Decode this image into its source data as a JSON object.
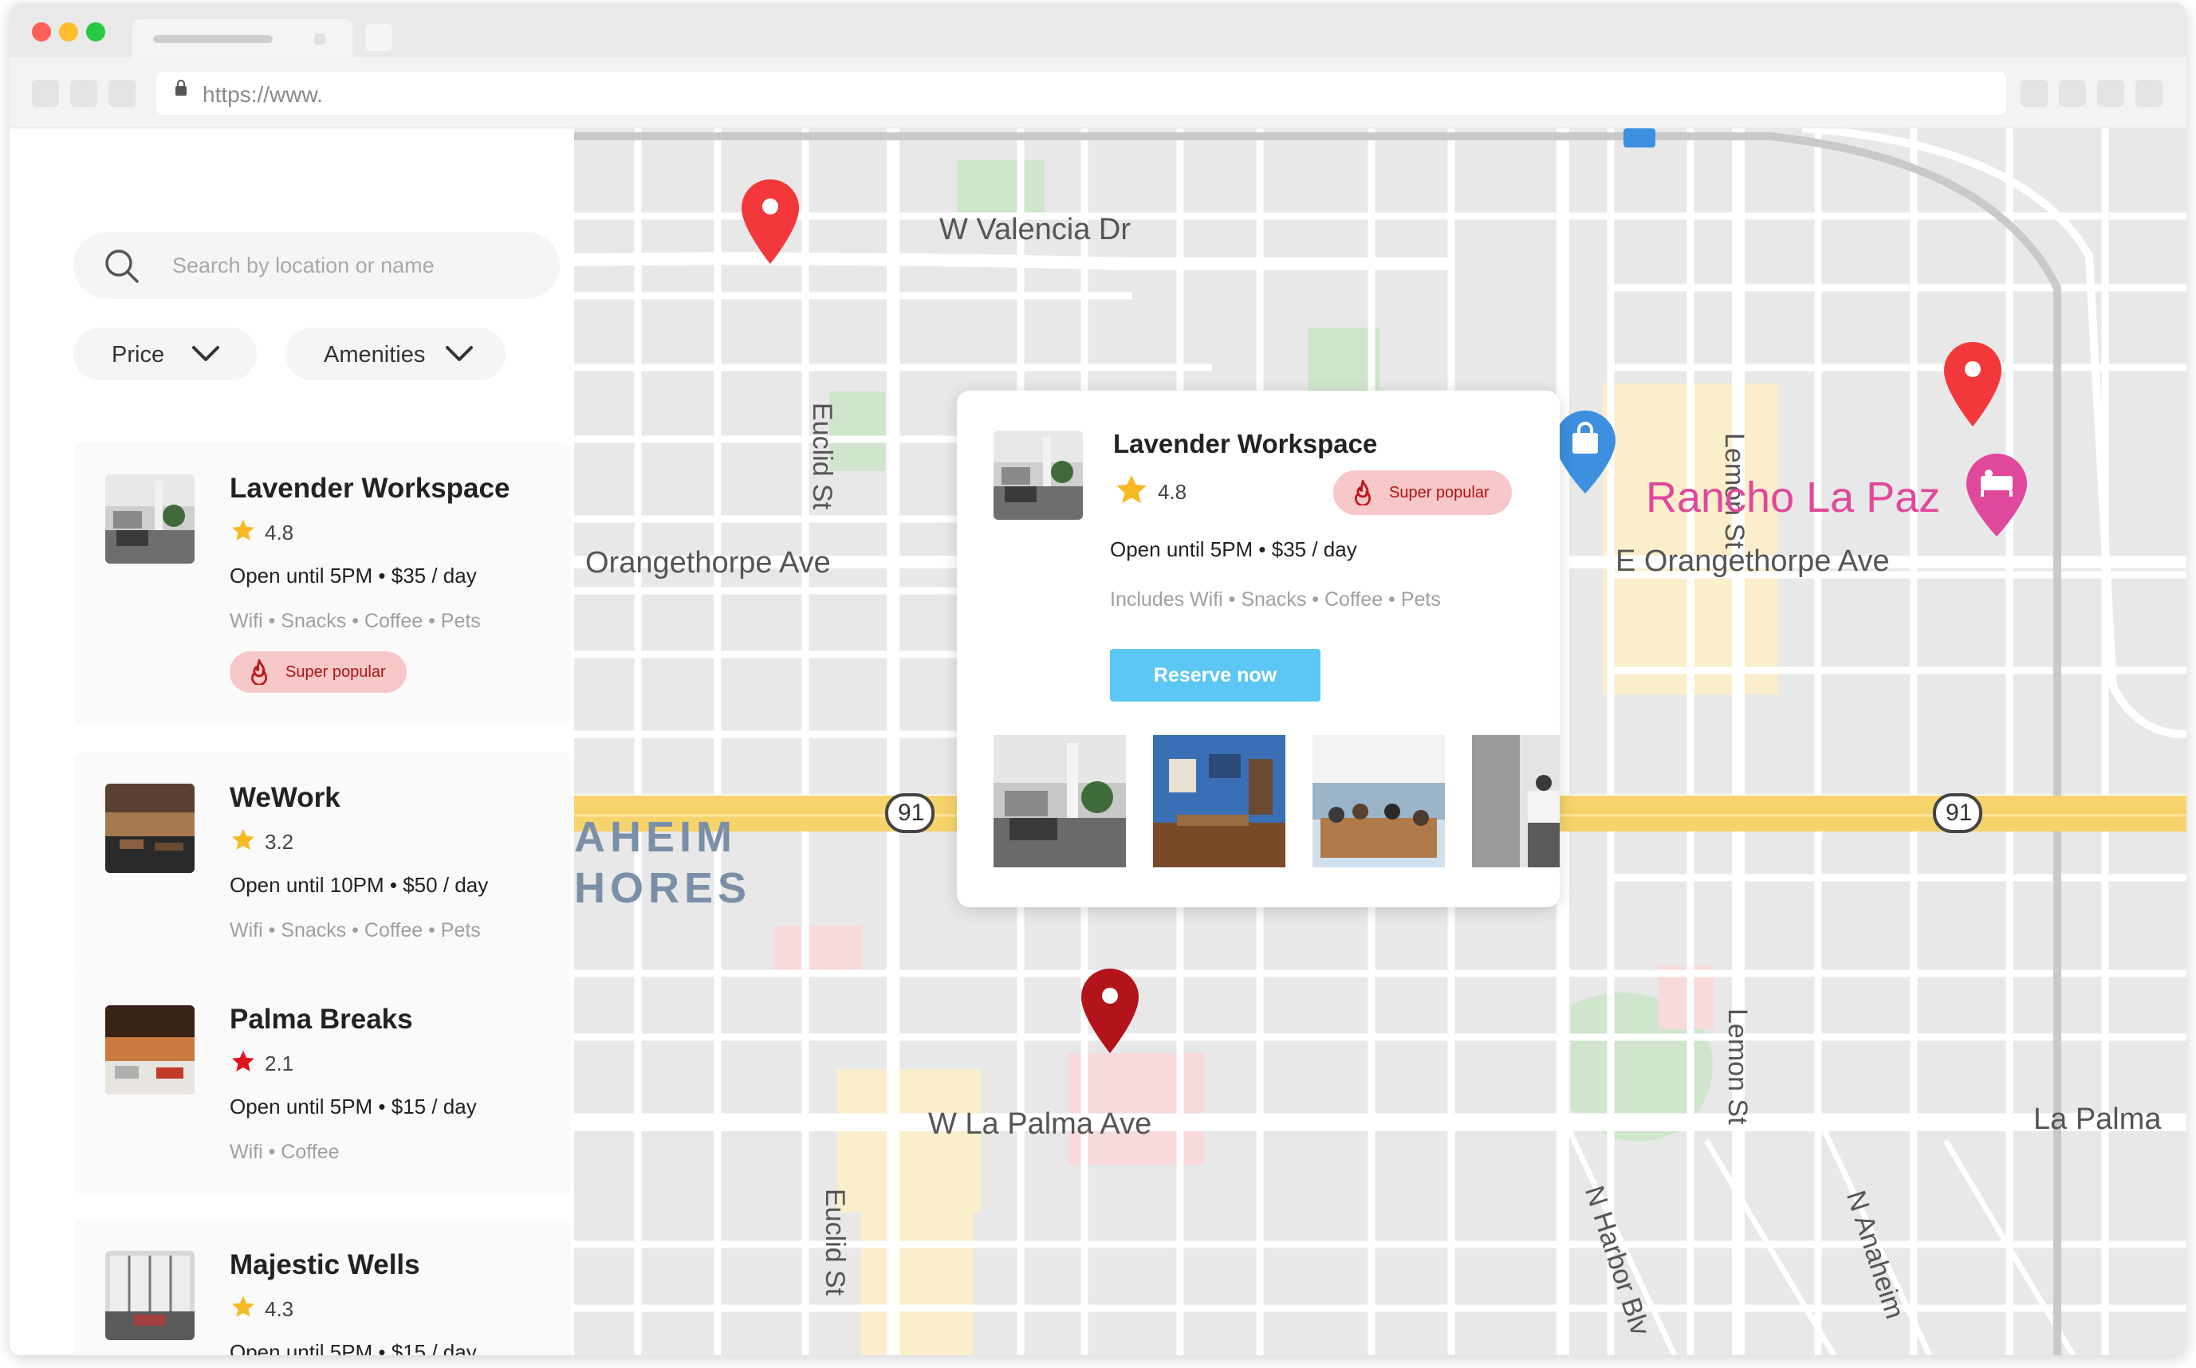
{
  "browser": {
    "url": "https://www."
  },
  "sidebar": {
    "search_placeholder": "Search by location or name",
    "filters": [
      {
        "label": "Price"
      },
      {
        "label": "Amenities"
      }
    ],
    "listings": [
      {
        "name": "Lavender Workspace",
        "rating": "4.8",
        "hours_price": "Open until 5PM • $35 / day",
        "amenities": "Wifi • Snacks • Coffee • Pets",
        "badge": "Super popular",
        "star_color": "#f7b924"
      },
      {
        "name": "WeWork",
        "rating": "3.2",
        "hours_price": "Open until 10PM • $50 / day",
        "amenities": "Wifi • Snacks • Coffee • Pets",
        "star_color": "#f7b924"
      },
      {
        "name": "Palma Breaks",
        "rating": "2.1",
        "hours_price": "Open until 5PM • $15 / day",
        "amenities": "Wifi • Coffee",
        "star_color": "#e0141e"
      },
      {
        "name": "Majestic Wells",
        "rating": "4.3",
        "hours_price": "Open until 5PM • $15 / day",
        "star_color": "#f7b924"
      }
    ]
  },
  "map": {
    "labels": {
      "valencia": "W Valencia Dr",
      "euclid_top": "Euclid St",
      "euclid_bottom": "Euclid St",
      "lemon_top": "Lemon St",
      "lemon_bottom": "Lemon St",
      "orangethorpe_w": "Orangethorpe Ave",
      "orangethorpe_e": "E Orangethorpe Ave",
      "rancho": "Rancho La Paz",
      "anaheim1": "AHEIM",
      "anaheim2": "HORES",
      "lapalma_w": "W La Palma Ave",
      "lapalma_e": "La Palma",
      "harbor": "N Harbor Blv",
      "anaheim_st": "N Anaheim",
      "hw91_left": "91",
      "hw91_right": "91"
    }
  },
  "popup": {
    "name": "Lavender Workspace",
    "rating": "4.8",
    "badge": "Super popular",
    "hours_price": "Open until 5PM • $35 / day",
    "amenities": "Includes Wifi • Snacks • Coffee • Pets",
    "reserve_label": "Reserve now"
  },
  "colors": {
    "accent": "#5bc7f2",
    "pin_red": "#f2383a",
    "pin_darkred": "#b3141b",
    "badge_bg": "#f8c8c8",
    "badge_text": "#b01212",
    "highway": "#f6d36b"
  }
}
